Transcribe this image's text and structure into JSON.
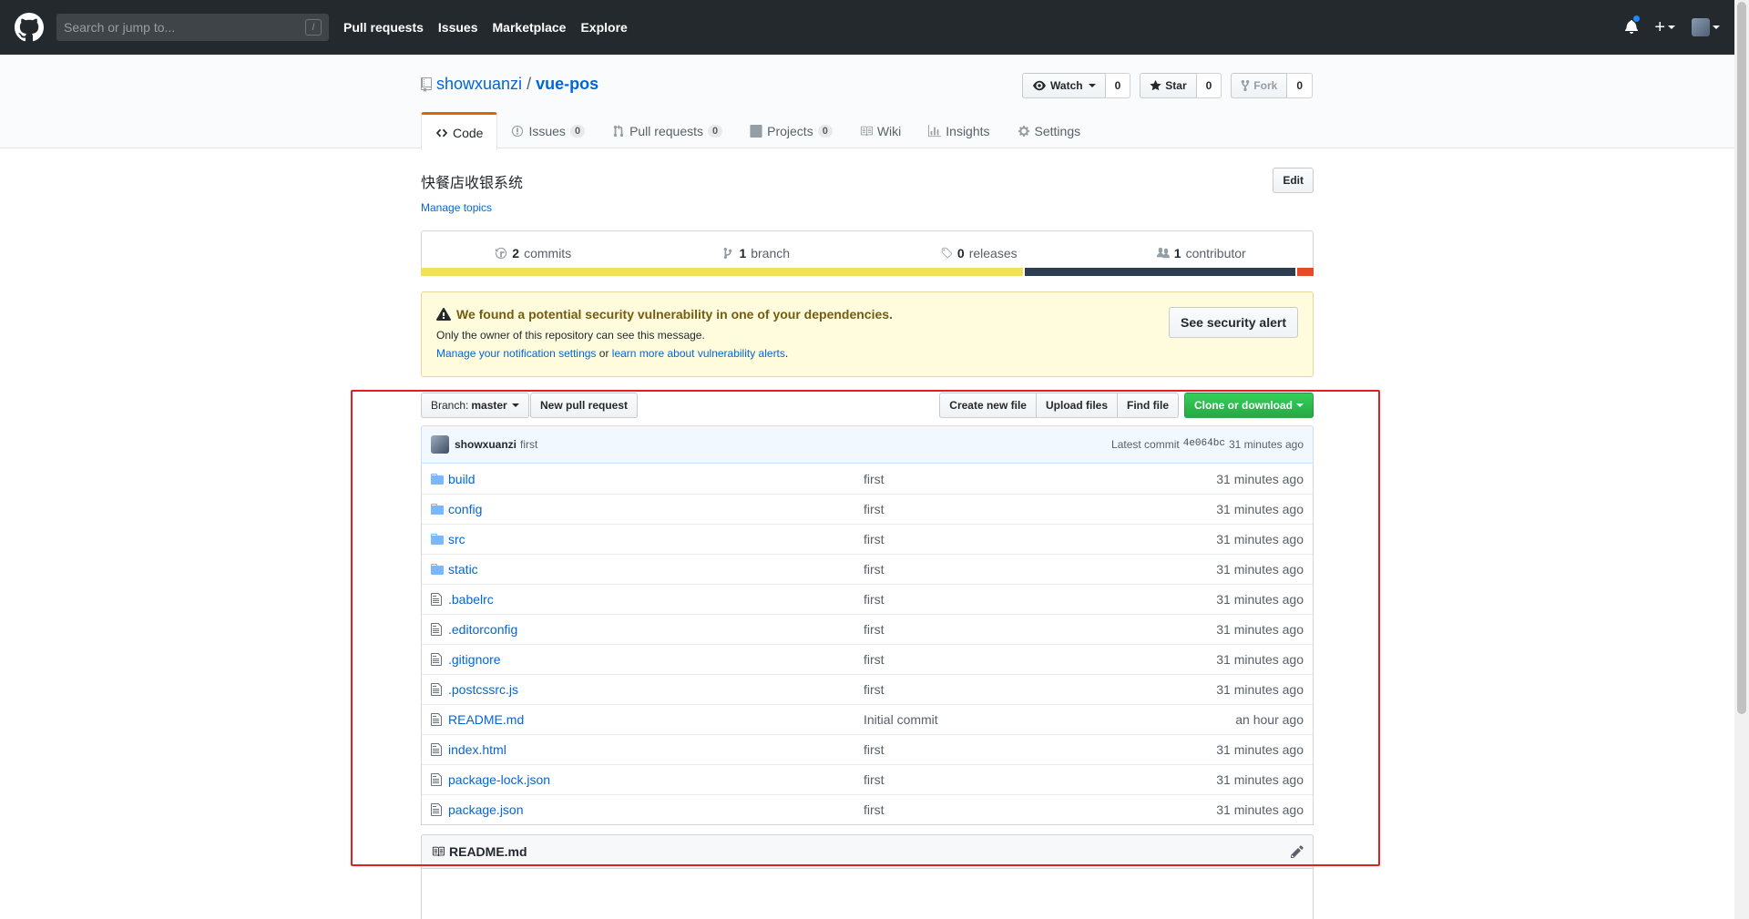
{
  "header": {
    "search_placeholder": "Search or jump to...",
    "search_key": "/",
    "nav": [
      "Pull requests",
      "Issues",
      "Marketplace",
      "Explore"
    ],
    "plus": "+"
  },
  "repo": {
    "owner": "showxuanzi",
    "separator": "/",
    "name": "vue-pos",
    "watch_label": "Watch",
    "watch_count": "0",
    "star_label": "Star",
    "star_count": "0",
    "fork_label": "Fork",
    "fork_count": "0",
    "tabs": [
      {
        "label": "Code",
        "count": ""
      },
      {
        "label": "Issues",
        "count": "0"
      },
      {
        "label": "Pull requests",
        "count": "0"
      },
      {
        "label": "Projects",
        "count": "0"
      },
      {
        "label": "Wiki",
        "count": ""
      },
      {
        "label": "Insights",
        "count": ""
      },
      {
        "label": "Settings",
        "count": ""
      }
    ],
    "description": "快餐店收银系统",
    "edit_label": "Edit",
    "manage_topics": "Manage topics"
  },
  "summary": {
    "commits_num": "2",
    "commits_label": "commits",
    "branch_num": "1",
    "branch_label": "branch",
    "releases_num": "0",
    "releases_label": "releases",
    "contributor_num": "1",
    "contributor_label": "contributor"
  },
  "language_colors": [
    "#f1e05a",
    "#2c3e50",
    "#e34c26"
  ],
  "language_shares": [
    0.674,
    0.306,
    0.02
  ],
  "alert": {
    "title": "We found a potential security vulnerability in one of your dependencies.",
    "subtitle": "Only the owner of this repository can see this message.",
    "link1": "Manage your notification settings",
    "or": "or",
    "link2": "learn more about vulnerability alerts",
    "period": ".",
    "button": "See security alert"
  },
  "file_nav": {
    "branch_prefix": "Branch:",
    "branch_name": "master",
    "new_pr": "New pull request",
    "create_file": "Create new file",
    "upload": "Upload files",
    "find": "Find file",
    "clone": "Clone or download"
  },
  "commit": {
    "author": "showxuanzi",
    "message": "first",
    "latest_label": "Latest commit",
    "sha": "4e064bc",
    "age": "31 minutes ago"
  },
  "files": [
    {
      "name": "build",
      "type": "dir",
      "message": "first",
      "age": "31 minutes ago"
    },
    {
      "name": "config",
      "type": "dir",
      "message": "first",
      "age": "31 minutes ago"
    },
    {
      "name": "src",
      "type": "dir",
      "message": "first",
      "age": "31 minutes ago"
    },
    {
      "name": "static",
      "type": "dir",
      "message": "first",
      "age": "31 minutes ago"
    },
    {
      "name": ".babelrc",
      "type": "file",
      "message": "first",
      "age": "31 minutes ago"
    },
    {
      "name": ".editorconfig",
      "type": "file",
      "message": "first",
      "age": "31 minutes ago"
    },
    {
      "name": ".gitignore",
      "type": "file",
      "message": "first",
      "age": "31 minutes ago"
    },
    {
      "name": ".postcssrc.js",
      "type": "file",
      "message": "first",
      "age": "31 minutes ago"
    },
    {
      "name": "README.md",
      "type": "file",
      "message": "Initial commit",
      "age": "an hour ago"
    },
    {
      "name": "index.html",
      "type": "file",
      "message": "first",
      "age": "31 minutes ago"
    },
    {
      "name": "package-lock.json",
      "type": "file",
      "message": "first",
      "age": "31 minutes ago"
    },
    {
      "name": "package.json",
      "type": "file",
      "message": "first",
      "age": "31 minutes ago"
    }
  ],
  "readme": {
    "title": "README.md"
  },
  "colors": {
    "header_bg": "#24292e",
    "link": "#0366d6",
    "primary_green": "#28a745",
    "tab_accent": "#e36209",
    "highlight": "#e02020"
  }
}
